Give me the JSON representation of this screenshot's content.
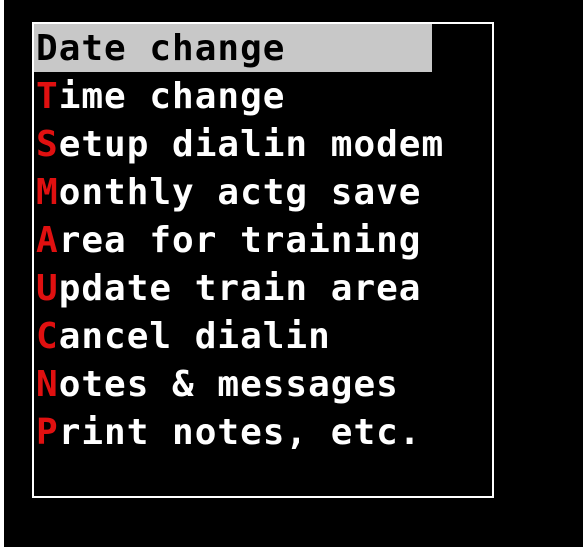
{
  "colors": {
    "background": "#000000",
    "text": "#ffffff",
    "hotkey": "#e01010",
    "selection_bg": "#c8c8c8",
    "selection_text": "#000000",
    "border": "#ffffff"
  },
  "menu": {
    "selected_index": 0,
    "items": [
      {
        "hotkey": "D",
        "rest": "ate change"
      },
      {
        "hotkey": "T",
        "rest": "ime change"
      },
      {
        "hotkey": "S",
        "rest": "etup dialin modem"
      },
      {
        "hotkey": "M",
        "rest": "onthly actg save"
      },
      {
        "hotkey": "A",
        "rest": "rea for training"
      },
      {
        "hotkey": "U",
        "rest": "pdate train area"
      },
      {
        "hotkey": "C",
        "rest": "ancel dialin"
      },
      {
        "hotkey": "N",
        "rest": "otes & messages"
      },
      {
        "hotkey": "P",
        "rest": "rint notes, etc."
      }
    ]
  }
}
